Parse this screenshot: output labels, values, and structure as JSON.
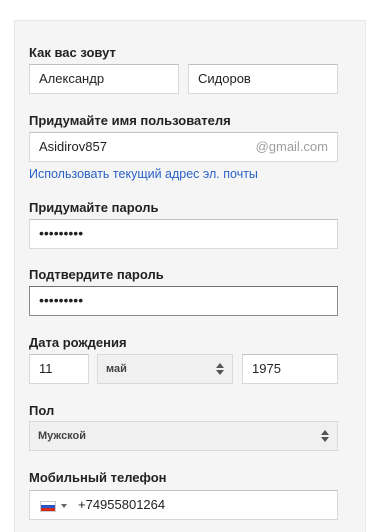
{
  "name": {
    "label": "Как вас зовут",
    "first": "Александр",
    "last": "Сидоров"
  },
  "username": {
    "label": "Придумайте имя пользователя",
    "value": "Asidirov857",
    "suffix": "@gmail.com",
    "link": "Использовать текущий адрес эл. почты"
  },
  "password": {
    "label": "Придумайте пароль",
    "value": "•••••••••"
  },
  "confirm_password": {
    "label": "Подтвердите пароль",
    "value": "•••••••••"
  },
  "birthdate": {
    "label": "Дата рождения",
    "day": "11",
    "month": "май",
    "year": "1975"
  },
  "gender": {
    "label": "Пол",
    "value": "Мужской"
  },
  "phone": {
    "label": "Мобильный телефон",
    "country_flag": "russia-flag-icon",
    "value": "+74955801264"
  },
  "colors": {
    "link": "#2a62c9",
    "panel_bg": "#f5f5f5"
  }
}
